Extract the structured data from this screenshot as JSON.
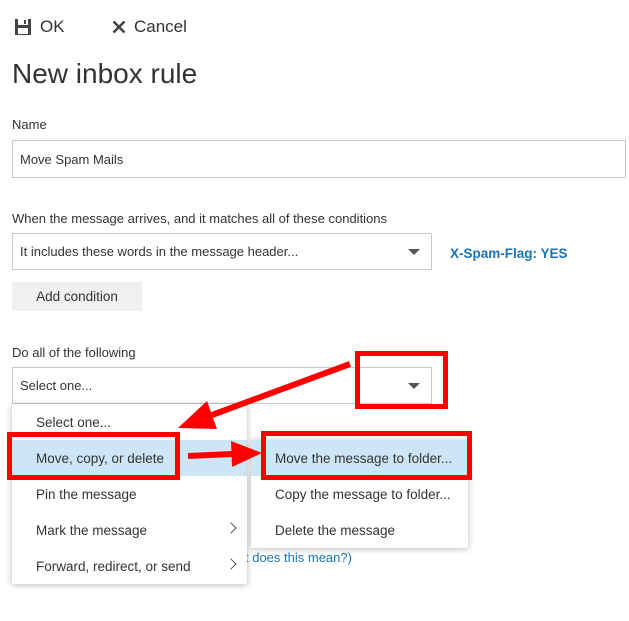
{
  "toolbar": {
    "ok_label": "OK",
    "cancel_label": "Cancel"
  },
  "page_title": "New inbox rule",
  "name_section": {
    "label": "Name",
    "value": "Move Spam Mails"
  },
  "conditions": {
    "label": "When the message arrives, and it matches all of these conditions",
    "selected": "It includes these words in the message header...",
    "value_link": "X-Spam-Flag: YES",
    "add_button": "Add condition"
  },
  "actions": {
    "label": "Do all of the following",
    "selected": "Select one...",
    "menu": [
      "Select one...",
      "Move, copy, or delete",
      "Pin the message",
      "Mark the message",
      "Forward, redirect, or send"
    ],
    "submenu": [
      "Move the message to folder...",
      "Copy the message to folder...",
      "Delete the message"
    ]
  },
  "helper_link_fragment": "t does this mean?)",
  "colors": {
    "accent": "#1a73b8",
    "highlight": "#cde6f7",
    "annotation": "#ff0000"
  }
}
